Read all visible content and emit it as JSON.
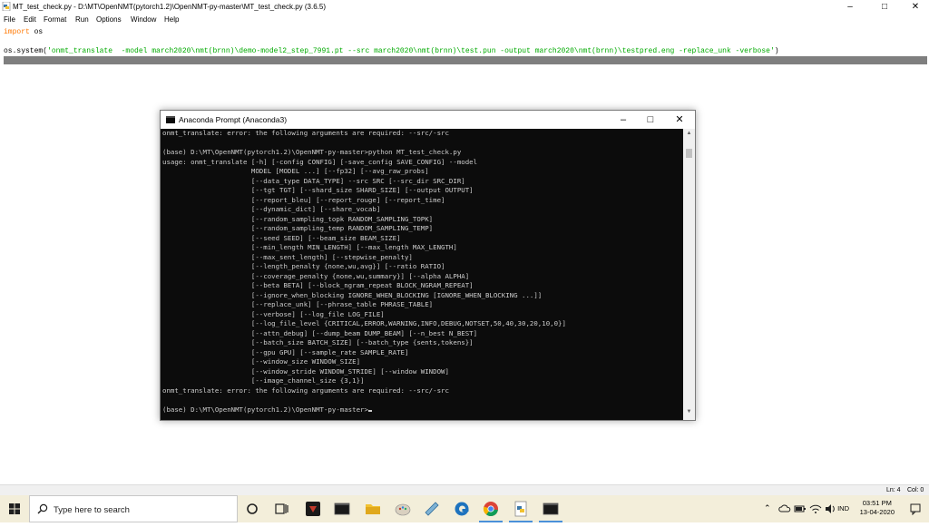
{
  "idle": {
    "title": "MT_test_check.py - D:\\MT\\OpenNMT(pytorch1.2)\\OpenNMT-py-master\\MT_test_check.py (3.6.5)",
    "menu": [
      "File",
      "Edit",
      "Format",
      "Run",
      "Options",
      "Window",
      "Help"
    ],
    "code": {
      "line1_kw": "import",
      "line1_rest": " os",
      "line3_prefix": "os.system(",
      "line3_string": "'onmt_translate  -model march2020\\nmt(brnn)\\demo-model2_step_7991.pt --src march2020\\nmt(brnn)\\test.pun -output march2020\\nmt(brnn)\\testpred.eng -replace_unk -verbose'",
      "line3_suffix": ")"
    },
    "status": {
      "line": "Ln: 4",
      "col": "Col: 0"
    }
  },
  "anaconda": {
    "title": "Anaconda Prompt (Anaconda3)",
    "lines": [
      "onmt_translate: error: the following arguments are required: --src/-src",
      "",
      "(base) D:\\MT\\OpenNMT(pytorch1.2)\\OpenNMT-py-master>python MT_test_check.py",
      "usage: onmt_translate [-h] [-config CONFIG] [-save_config SAVE_CONFIG] --model",
      "                      MODEL [MODEL ...] [--fp32] [--avg_raw_probs]",
      "                      [--data_type DATA_TYPE] --src SRC [--src_dir SRC_DIR]",
      "                      [--tgt TGT] [--shard_size SHARD_SIZE] [--output OUTPUT]",
      "                      [--report_bleu] [--report_rouge] [--report_time]",
      "                      [--dynamic_dict] [--share_vocab]",
      "                      [--random_sampling_topk RANDOM_SAMPLING_TOPK]",
      "                      [--random_sampling_temp RANDOM_SAMPLING_TEMP]",
      "                      [--seed SEED] [--beam_size BEAM_SIZE]",
      "                      [--min_length MIN_LENGTH] [--max_length MAX_LENGTH]",
      "                      [--max_sent_length] [--stepwise_penalty]",
      "                      [--length_penalty {none,wu,avg}] [--ratio RATIO]",
      "                      [--coverage_penalty {none,wu,summary}] [--alpha ALPHA]",
      "                      [--beta BETA] [--block_ngram_repeat BLOCK_NGRAM_REPEAT]",
      "                      [--ignore_when_blocking IGNORE_WHEN_BLOCKING [IGNORE_WHEN_BLOCKING ...]]",
      "                      [--replace_unk] [--phrase_table PHRASE_TABLE]",
      "                      [--verbose] [--log_file LOG_FILE]",
      "                      [--log_file_level {CRITICAL,ERROR,WARNING,INFO,DEBUG,NOTSET,50,40,30,20,10,0}]",
      "                      [--attn_debug] [--dump_beam DUMP_BEAM] [--n_best N_BEST]",
      "                      [--batch_size BATCH_SIZE] [--batch_type {sents,tokens}]",
      "                      [--gpu GPU] [--sample_rate SAMPLE_RATE]",
      "                      [--window_size WINDOW_SIZE]",
      "                      [--window_stride WINDOW_STRIDE] [--window WINDOW]",
      "                      [--image_channel_size {3,1}]",
      "onmt_translate: error: the following arguments are required: --src/-src",
      "",
      "(base) D:\\MT\\OpenNMT(pytorch1.2)\\OpenNMT-py-master>"
    ]
  },
  "taskbar": {
    "search_placeholder": "Type here to search",
    "tray_lang": "IND",
    "time": "03:51 PM",
    "date": "13-04-2020"
  },
  "colors": {
    "keyword": "#ff7700",
    "string": "#00aa00",
    "console_bg": "#0c0c0c",
    "console_fg": "#cccccc",
    "taskbar_bg": "#f3eeda"
  }
}
